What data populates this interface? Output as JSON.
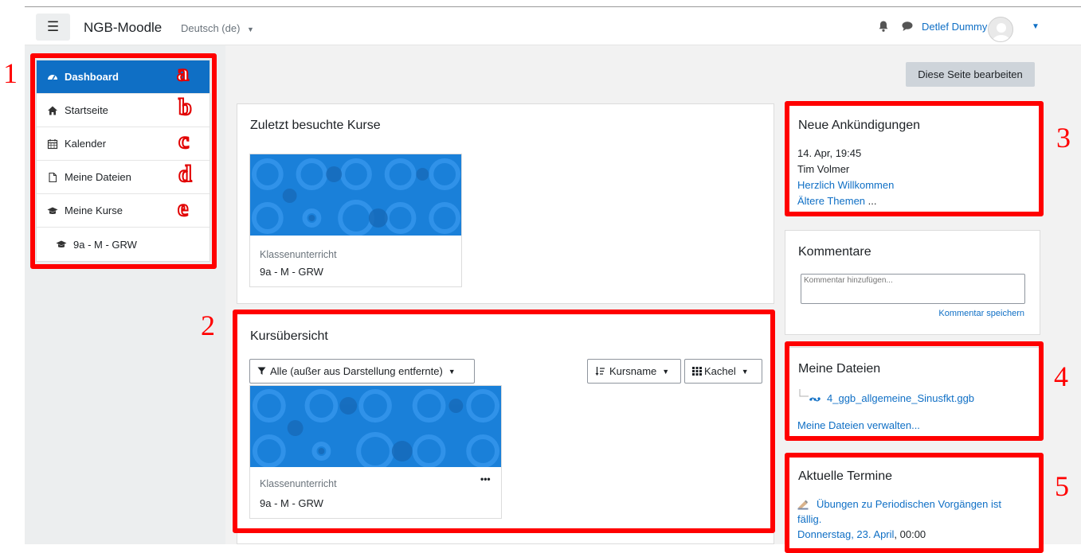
{
  "navbar": {
    "brand": "NGB-Moodle",
    "language": "Deutsch (de)",
    "user_name": "Detlef Dummy"
  },
  "sidebar": {
    "items": [
      {
        "label": "Dashboard",
        "icon": "dashboard-icon",
        "active": true
      },
      {
        "label": "Startseite",
        "icon": "home-icon"
      },
      {
        "label": "Kalender",
        "icon": "calendar-icon"
      },
      {
        "label": "Meine Dateien",
        "icon": "file-icon"
      },
      {
        "label": "Meine Kurse",
        "icon": "graduation-cap-icon"
      },
      {
        "label": "9a - M - GRW",
        "icon": "graduation-cap-icon"
      }
    ]
  },
  "annotations": {
    "numbers": [
      "1",
      "2",
      "3",
      "4",
      "5"
    ],
    "letters": [
      "a",
      "b",
      "c",
      "d",
      "e"
    ],
    "color": "#ff0000"
  },
  "main": {
    "edit_button": "Diese Seite bearbeiten",
    "recent_courses": {
      "title": "Zuletzt besuchte Kurse",
      "course": {
        "category": "Klassenunterricht",
        "name": "9a - M - GRW"
      }
    },
    "overview": {
      "title": "Kursübersicht",
      "filter": "Alle (außer aus Darstellung entfernte)",
      "sort": "Kursname",
      "view": "Kachel",
      "course": {
        "category": "Klassenunterricht",
        "name": "9a - M - GRW",
        "menu": "•••"
      }
    }
  },
  "blocks": {
    "announcements": {
      "title": "Neue Ankündigungen",
      "date": "14. Apr, 19:45",
      "author": "Tim Volmer",
      "post": "Herzlich Willkommen",
      "older_link": "Ältere Themen",
      "older_suffix": " ..."
    },
    "comments": {
      "title": "Kommentare",
      "placeholder": "Kommentar hinzufügen...",
      "save": "Kommentar speichern"
    },
    "files": {
      "title": "Meine Dateien",
      "file": "4_ggb_allgemeine_Sinusfkt.ggb",
      "manage": "Meine Dateien verwalten..."
    },
    "events": {
      "title": "Aktuelle Termine",
      "event_line1": "Übungen zu Periodischen Vorgängen ist",
      "event_line2": "fällig.",
      "date_link": "Donnerstag, 23. April",
      "time": ", 00:00"
    }
  },
  "colors": {
    "primary": "#0f6fc5",
    "course_image": "#1a80d9",
    "annotation": "#ff0000"
  }
}
